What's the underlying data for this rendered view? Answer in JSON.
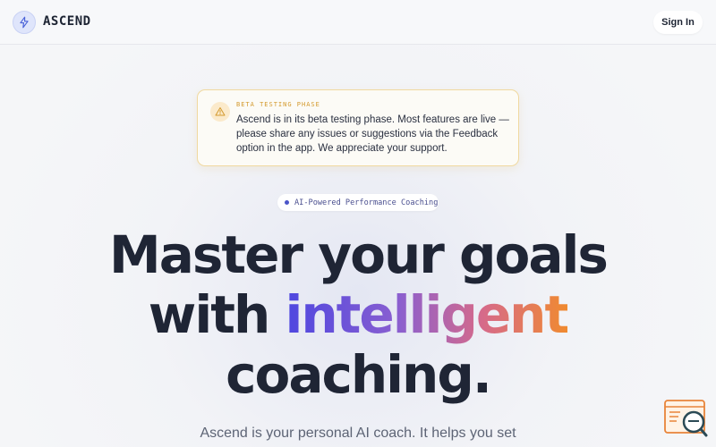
{
  "header": {
    "brand": "ASCEND",
    "signin_label": "Sign In"
  },
  "beta_notice": {
    "label": "BETA TESTING PHASE",
    "text": "Ascend is in its beta testing phase. Most features are live — please share any issues or suggestions via the Feedback option in the app. We appreciate your support."
  },
  "hero": {
    "pill": "AI-Powered Performance Coaching",
    "headline_line1": "Master your goals",
    "headline_line2_prefix": "with ",
    "headline_line2_highlight": "intelligent",
    "headline_line3": "coaching.",
    "subtitle": "Ascend is your personal AI coach. It helps you set"
  },
  "icons": {
    "logo": "lightning-bolt-icon",
    "beta": "warning-triangle-icon",
    "feedback": "feedback-search-icon"
  },
  "colors": {
    "accent": "#4b55c8",
    "warning": "#d49a2e",
    "gradient_start": "#4d46e0",
    "gradient_end": "#f08a30",
    "text_dark": "#1f2535"
  }
}
